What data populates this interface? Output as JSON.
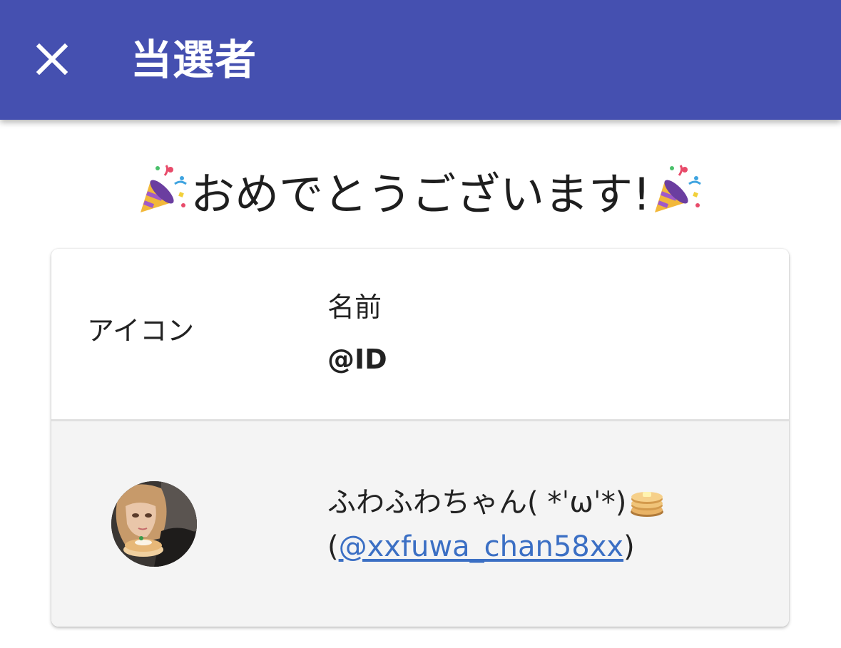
{
  "appbar": {
    "title": "当選者",
    "close_icon": "close-icon"
  },
  "congrats": {
    "text": "おめでとうございます!",
    "left_icon": "party-popper-icon",
    "right_icon": "party-popper-icon"
  },
  "table": {
    "headers": {
      "icon": "アイコン",
      "name": "名前",
      "id": "@ID"
    },
    "rows": [
      {
        "avatar": "avatar",
        "name": "ふわふわちゃん( *ˈωˈ*)",
        "name_emoji": "pancakes-icon",
        "id_open": "(",
        "id": "@xxfuwa_chan58xx",
        "id_close": ")"
      }
    ]
  },
  "colors": {
    "appbar": "#4550b0",
    "link": "#3b6fc4",
    "row_bg": "#f4f4f4"
  }
}
